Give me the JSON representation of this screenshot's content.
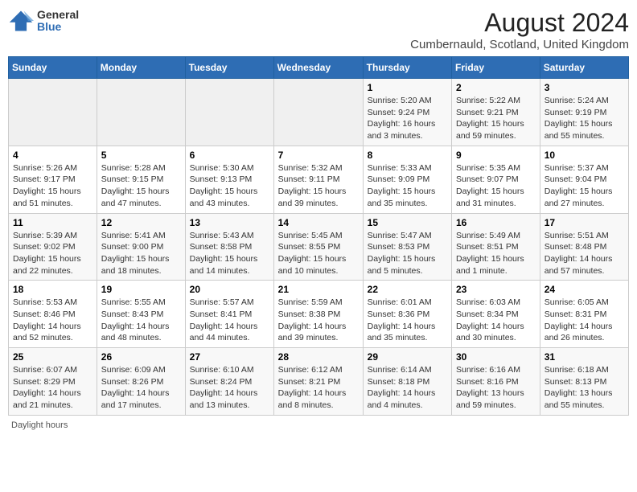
{
  "header": {
    "logo": {
      "general": "General",
      "blue": "Blue"
    },
    "title": "August 2024",
    "location": "Cumbernauld, Scotland, United Kingdom"
  },
  "calendar": {
    "weekdays": [
      "Sunday",
      "Monday",
      "Tuesday",
      "Wednesday",
      "Thursday",
      "Friday",
      "Saturday"
    ],
    "weeks": [
      [
        {
          "day": "",
          "info": ""
        },
        {
          "day": "",
          "info": ""
        },
        {
          "day": "",
          "info": ""
        },
        {
          "day": "",
          "info": ""
        },
        {
          "day": "1",
          "info": "Sunrise: 5:20 AM\nSunset: 9:24 PM\nDaylight: 16 hours\nand 3 minutes."
        },
        {
          "day": "2",
          "info": "Sunrise: 5:22 AM\nSunset: 9:21 PM\nDaylight: 15 hours\nand 59 minutes."
        },
        {
          "day": "3",
          "info": "Sunrise: 5:24 AM\nSunset: 9:19 PM\nDaylight: 15 hours\nand 55 minutes."
        }
      ],
      [
        {
          "day": "4",
          "info": "Sunrise: 5:26 AM\nSunset: 9:17 PM\nDaylight: 15 hours\nand 51 minutes."
        },
        {
          "day": "5",
          "info": "Sunrise: 5:28 AM\nSunset: 9:15 PM\nDaylight: 15 hours\nand 47 minutes."
        },
        {
          "day": "6",
          "info": "Sunrise: 5:30 AM\nSunset: 9:13 PM\nDaylight: 15 hours\nand 43 minutes."
        },
        {
          "day": "7",
          "info": "Sunrise: 5:32 AM\nSunset: 9:11 PM\nDaylight: 15 hours\nand 39 minutes."
        },
        {
          "day": "8",
          "info": "Sunrise: 5:33 AM\nSunset: 9:09 PM\nDaylight: 15 hours\nand 35 minutes."
        },
        {
          "day": "9",
          "info": "Sunrise: 5:35 AM\nSunset: 9:07 PM\nDaylight: 15 hours\nand 31 minutes."
        },
        {
          "day": "10",
          "info": "Sunrise: 5:37 AM\nSunset: 9:04 PM\nDaylight: 15 hours\nand 27 minutes."
        }
      ],
      [
        {
          "day": "11",
          "info": "Sunrise: 5:39 AM\nSunset: 9:02 PM\nDaylight: 15 hours\nand 22 minutes."
        },
        {
          "day": "12",
          "info": "Sunrise: 5:41 AM\nSunset: 9:00 PM\nDaylight: 15 hours\nand 18 minutes."
        },
        {
          "day": "13",
          "info": "Sunrise: 5:43 AM\nSunset: 8:58 PM\nDaylight: 15 hours\nand 14 minutes."
        },
        {
          "day": "14",
          "info": "Sunrise: 5:45 AM\nSunset: 8:55 PM\nDaylight: 15 hours\nand 10 minutes."
        },
        {
          "day": "15",
          "info": "Sunrise: 5:47 AM\nSunset: 8:53 PM\nDaylight: 15 hours\nand 5 minutes."
        },
        {
          "day": "16",
          "info": "Sunrise: 5:49 AM\nSunset: 8:51 PM\nDaylight: 15 hours\nand 1 minute."
        },
        {
          "day": "17",
          "info": "Sunrise: 5:51 AM\nSunset: 8:48 PM\nDaylight: 14 hours\nand 57 minutes."
        }
      ],
      [
        {
          "day": "18",
          "info": "Sunrise: 5:53 AM\nSunset: 8:46 PM\nDaylight: 14 hours\nand 52 minutes."
        },
        {
          "day": "19",
          "info": "Sunrise: 5:55 AM\nSunset: 8:43 PM\nDaylight: 14 hours\nand 48 minutes."
        },
        {
          "day": "20",
          "info": "Sunrise: 5:57 AM\nSunset: 8:41 PM\nDaylight: 14 hours\nand 44 minutes."
        },
        {
          "day": "21",
          "info": "Sunrise: 5:59 AM\nSunset: 8:38 PM\nDaylight: 14 hours\nand 39 minutes."
        },
        {
          "day": "22",
          "info": "Sunrise: 6:01 AM\nSunset: 8:36 PM\nDaylight: 14 hours\nand 35 minutes."
        },
        {
          "day": "23",
          "info": "Sunrise: 6:03 AM\nSunset: 8:34 PM\nDaylight: 14 hours\nand 30 minutes."
        },
        {
          "day": "24",
          "info": "Sunrise: 6:05 AM\nSunset: 8:31 PM\nDaylight: 14 hours\nand 26 minutes."
        }
      ],
      [
        {
          "day": "25",
          "info": "Sunrise: 6:07 AM\nSunset: 8:29 PM\nDaylight: 14 hours\nand 21 minutes."
        },
        {
          "day": "26",
          "info": "Sunrise: 6:09 AM\nSunset: 8:26 PM\nDaylight: 14 hours\nand 17 minutes."
        },
        {
          "day": "27",
          "info": "Sunrise: 6:10 AM\nSunset: 8:24 PM\nDaylight: 14 hours\nand 13 minutes."
        },
        {
          "day": "28",
          "info": "Sunrise: 6:12 AM\nSunset: 8:21 PM\nDaylight: 14 hours\nand 8 minutes."
        },
        {
          "day": "29",
          "info": "Sunrise: 6:14 AM\nSunset: 8:18 PM\nDaylight: 14 hours\nand 4 minutes."
        },
        {
          "day": "30",
          "info": "Sunrise: 6:16 AM\nSunset: 8:16 PM\nDaylight: 13 hours\nand 59 minutes."
        },
        {
          "day": "31",
          "info": "Sunrise: 6:18 AM\nSunset: 8:13 PM\nDaylight: 13 hours\nand 55 minutes."
        }
      ]
    ]
  },
  "footer": {
    "daylight_label": "Daylight hours"
  }
}
